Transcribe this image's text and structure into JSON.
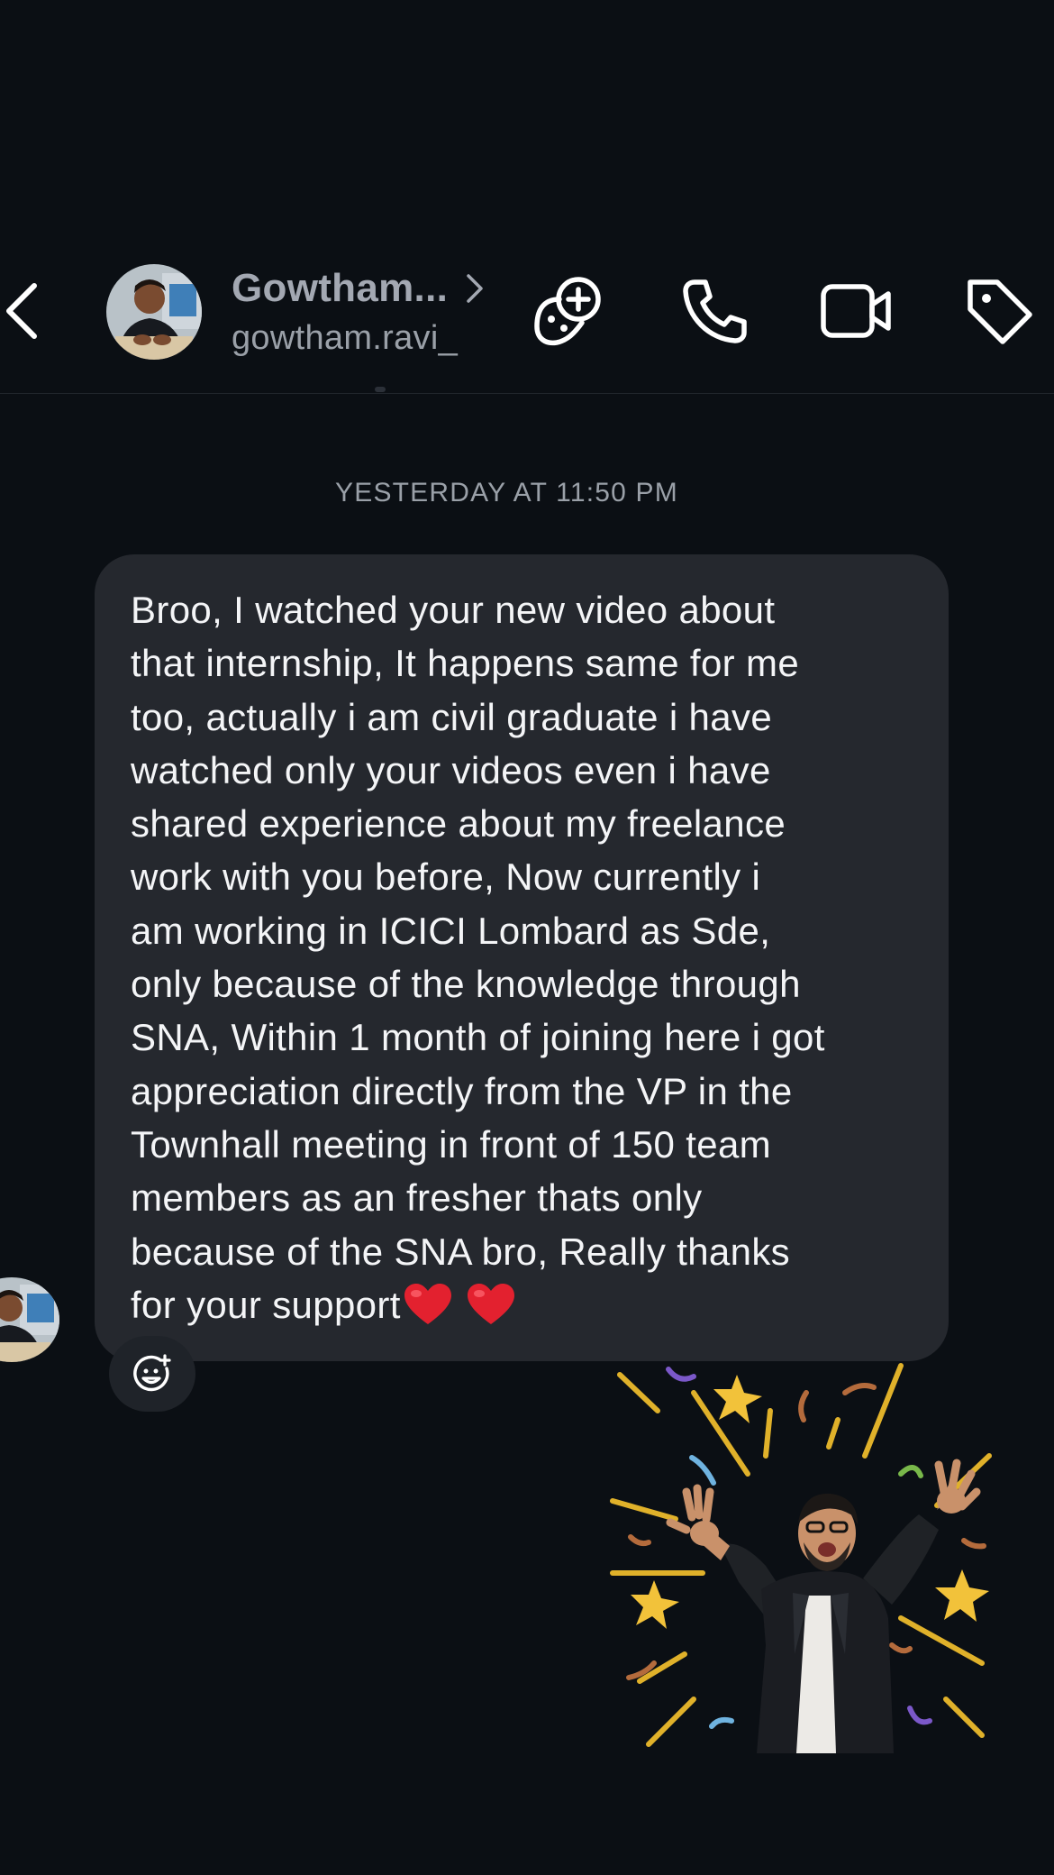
{
  "contact": {
    "display_name": "Gowtham...",
    "username": "gowtham.ravi_"
  },
  "icons": {
    "back": "chevron-left-icon",
    "profile_arrow": "chevron-right-icon",
    "games": "game-controller-add-icon",
    "call": "phone-icon",
    "video": "video-camera-icon",
    "tag": "tag-icon",
    "react": "add-reaction-icon"
  },
  "thread": {
    "timestamp": "YESTERDAY AT 11:50 PM",
    "message": {
      "text": "Broo, I watched your new video about\nthat internship, It happens same for me\ntoo, actually i am civil graduate i have\nwatched only your videos even i have\nshared experience about my freelance\nwork with you before, Now currently i\nam working in ICICI Lombard as Sde,\nonly because of the knowledge through\nSNA, Within 1 month of joining here i got\nappreciation directly from the VP in the\nTownhall meeting in front of 150 team\nmembers as an fresher thats only\nbecause of the SNA bro, Really thanks\nfor your support",
      "emoji": [
        "red-heart",
        "red-heart"
      ]
    },
    "sticker": "celebration-avatar-sticker"
  },
  "colors": {
    "background": "#0b0f14",
    "bubble": "#25282e",
    "text": "#f4f5f7",
    "muted": "#9aa0a8"
  }
}
